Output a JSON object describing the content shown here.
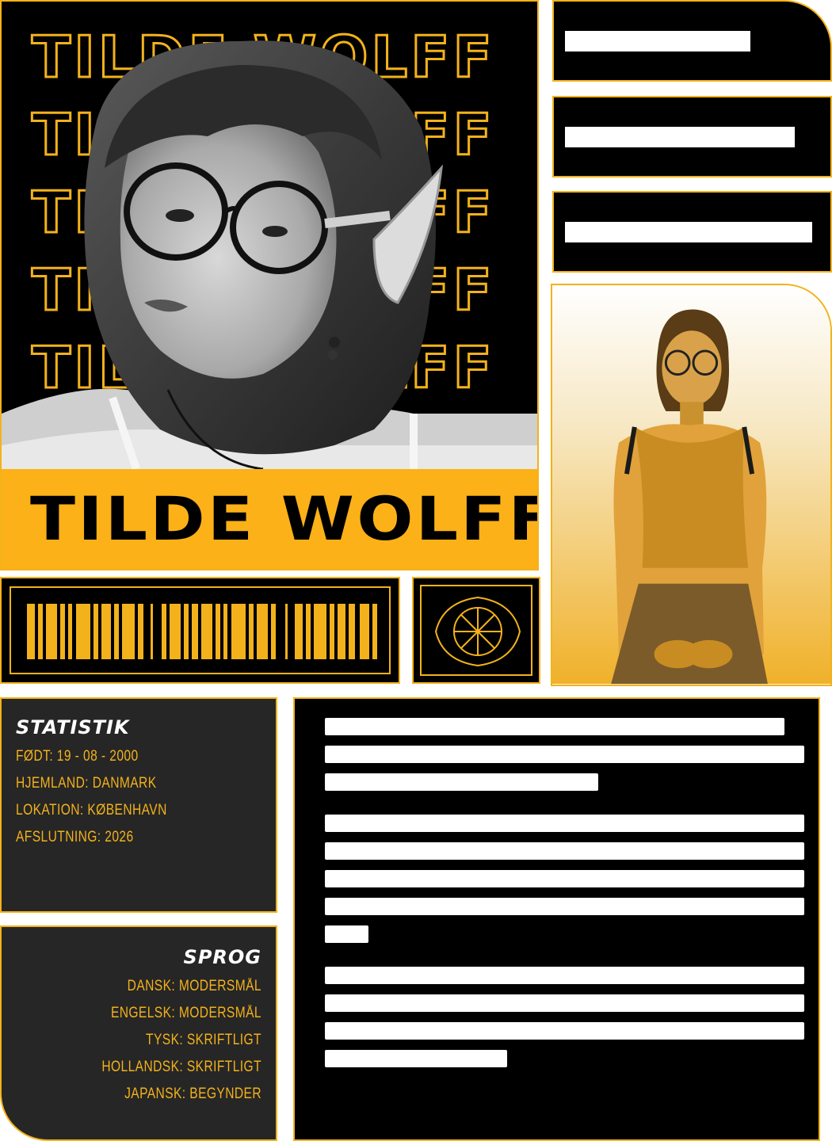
{
  "hero": {
    "outline_name": "TILDE WOLFF",
    "name": "TILDE WOLFF"
  },
  "right_boxes": [
    {
      "label": ""
    },
    {
      "label": ""
    },
    {
      "label": ""
    }
  ],
  "stats": {
    "heading": "STATISTIK",
    "items": [
      "FØDT: 19 - 08 - 2000",
      "HJEMLAND: DANMARK",
      "LOKATION: KØBENHAVN",
      "AFSLUTNING: 2026"
    ]
  },
  "languages": {
    "heading": "SPROG",
    "items": [
      "DANSK: MODERSMÅL",
      "ENGELSK: MODERSMÅL",
      "TYSK: SKRIFTLIGT",
      "HOLLANDSK: SKRIFTLIGT",
      "JAPANSK: BEGYNDER"
    ]
  },
  "colors": {
    "accent": "#f3b21b",
    "panel": "#262626",
    "background": "#000000"
  }
}
